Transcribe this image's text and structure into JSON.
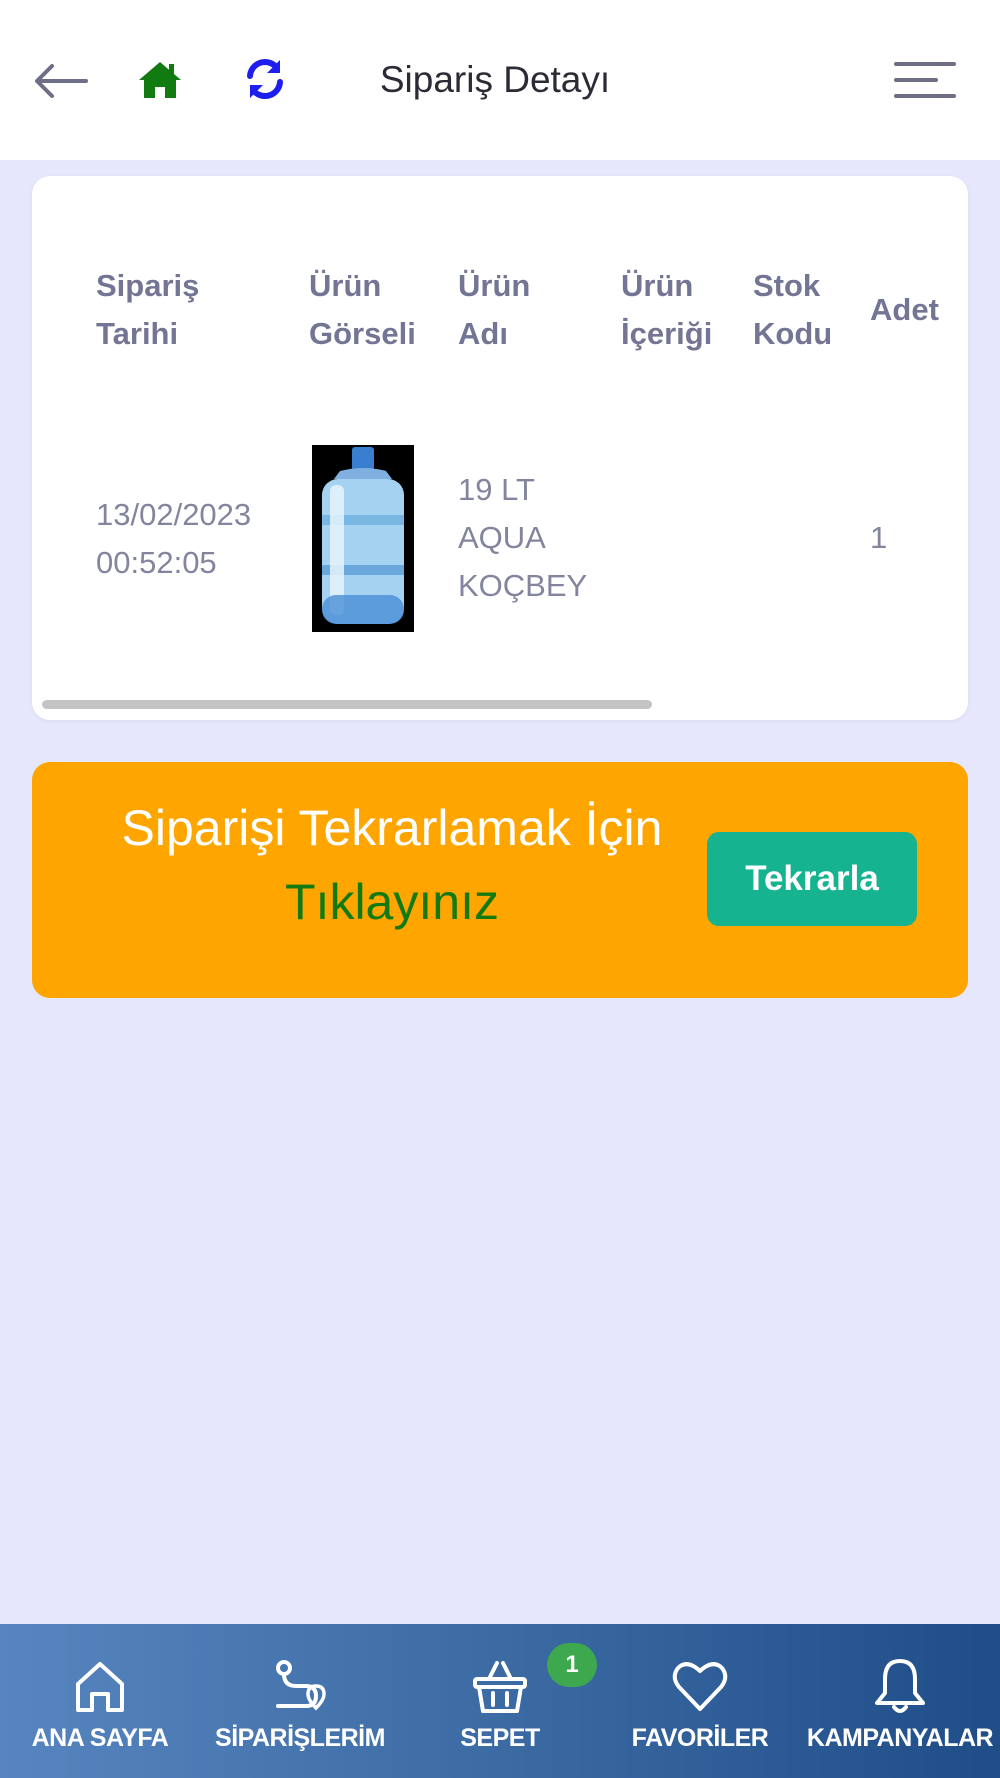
{
  "header": {
    "title": "Sipariş Detayı",
    "icons": {
      "back": "arrow-left-icon",
      "home": "home-icon",
      "refresh": "refresh-icon",
      "menu": "hamburger-menu-icon"
    },
    "colors": {
      "home": "#117a11",
      "refresh": "#1e1ef0"
    }
  },
  "order_table": {
    "headers": {
      "date": [
        "Sipariş",
        "Tarihi"
      ],
      "image": [
        "Ürün",
        "Görseli"
      ],
      "name": [
        "Ürün",
        "Adı"
      ],
      "content": [
        "Ürün",
        "İçeriği"
      ],
      "stock": [
        "Stok",
        "Kodu"
      ],
      "qty": "Adet"
    },
    "row": {
      "date": [
        "13/02/2023",
        "00:52:05"
      ],
      "name": [
        "19 LT",
        "AQUA",
        "KOÇBEY"
      ],
      "content": "",
      "stock": "",
      "qty": "1"
    }
  },
  "repeat_banner": {
    "line1": "Siparişi Tekrarlamak İçin",
    "line2": "Tıklayınız",
    "button_label": "Tekrarla",
    "colors": {
      "background": "#ffa500",
      "button": "#15b38f",
      "line2": "#117a11"
    }
  },
  "bottom_nav": {
    "items": [
      {
        "label": "ANA SAYFA",
        "icon": "home-outline-icon"
      },
      {
        "label": "SİPARİŞLERİM",
        "icon": "route-icon"
      },
      {
        "label": "SEPET",
        "icon": "basket-icon"
      },
      {
        "label": "FAVORİLER",
        "icon": "heart-icon"
      },
      {
        "label": "KAMPANYALAR",
        "icon": "bell-icon"
      }
    ],
    "cart_badge": "1"
  }
}
